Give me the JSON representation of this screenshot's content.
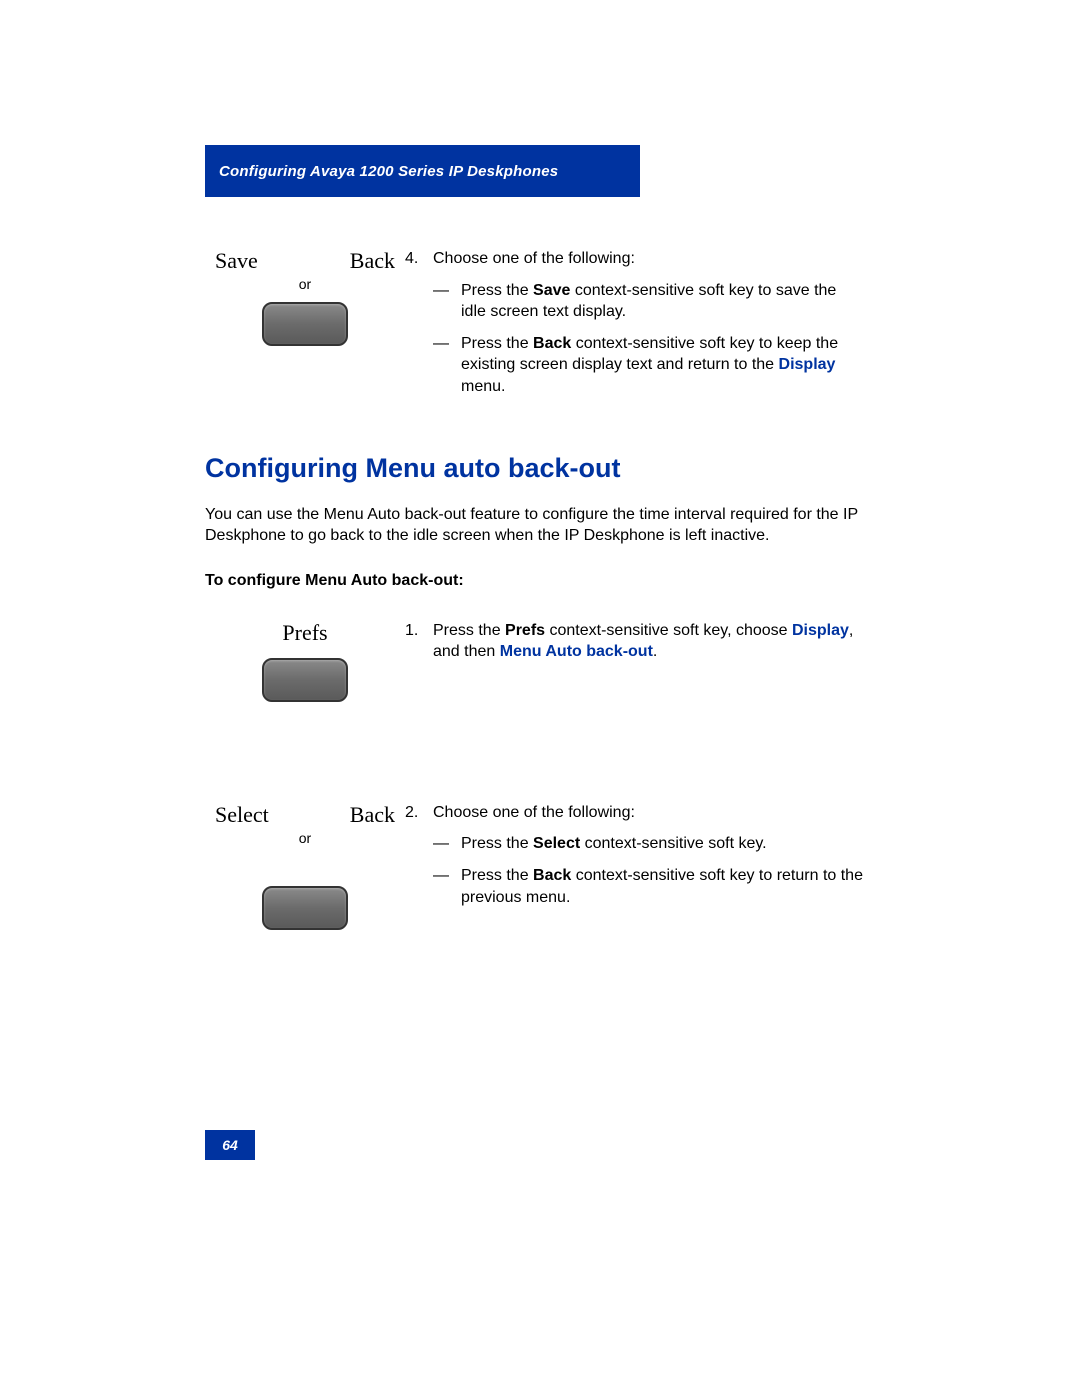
{
  "header": "Configuring Avaya 1200 Series IP Deskphones",
  "softkeys": {
    "save": "Save",
    "back": "Back",
    "prefs": "Prefs",
    "select": "Select",
    "or": "or"
  },
  "step4": {
    "num": "4.",
    "intro": "Choose one of the following:",
    "dash": "—",
    "item1_a": "Press the ",
    "item1_b": "Save",
    "item1_c": " context-sensitive soft key to save the idle screen text display.",
    "item2_a": "Press the ",
    "item2_b": "Back",
    "item2_c": " context-sensitive soft key to keep the existing screen display text and return to the ",
    "item2_d": "Display",
    "item2_e": " menu."
  },
  "section_heading": "Configuring Menu auto back-out",
  "intro_para": "You can use the Menu Auto back-out feature to configure the time interval required for the IP Deskphone to go back to the idle screen when the IP Deskphone is left inactive.",
  "sub_heading": "To configure Menu Auto back-out:",
  "step1": {
    "num": "1.",
    "a": "Press the ",
    "b": "Prefs",
    "c": " context-sensitive soft key, choose ",
    "d": "Display",
    "e": ", and then ",
    "f": "Menu Auto back-out",
    "g": "."
  },
  "step2": {
    "num": "2.",
    "intro": "Choose one of the following:",
    "dash": "—",
    "item1_a": "Press the ",
    "item1_b": "Select",
    "item1_c": " context-sensitive soft key.",
    "item2_a": "Press the ",
    "item2_b": "Back",
    "item2_c": " context-sensitive soft key to return to the previous menu."
  },
  "page_number": "64"
}
